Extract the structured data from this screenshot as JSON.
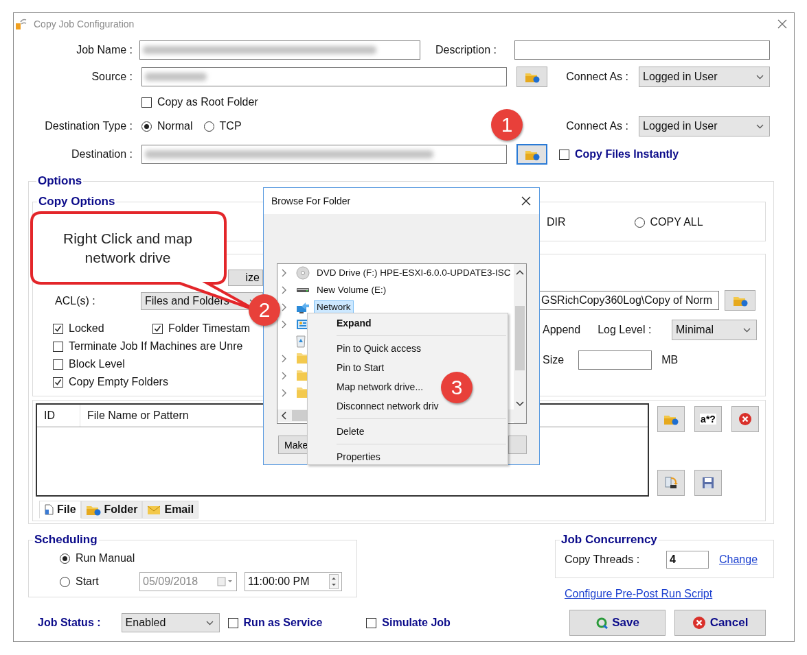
{
  "window": {
    "title": "Copy Job Configuration"
  },
  "job_name": {
    "label": "Job Name :"
  },
  "description": {
    "label": "Description :"
  },
  "source": {
    "label": "Source :",
    "connect_as_label": "Connect As :",
    "connect_as": "Logged in User"
  },
  "copy_as_root_folder": {
    "label": "Copy as Root Folder",
    "checked": false
  },
  "destination_type": {
    "label": "Destination Type :",
    "connect_as_label": "Connect As :",
    "connect_as": "Logged in User",
    "options": [
      {
        "label": "Normal",
        "selected": true
      },
      {
        "label": "TCP",
        "selected": false
      }
    ]
  },
  "destination": {
    "label": "Destination :",
    "browse_focused": true,
    "copy_files_instantly": {
      "label": "Copy Files Instantly",
      "checked": false
    }
  },
  "options": {
    "title": "Options",
    "copy_options": {
      "title": "Copy Options",
      "choices": [
        {
          "label": "DIR"
        },
        {
          "label": "COPY ALL",
          "selected": false
        }
      ]
    },
    "size_button": "ize",
    "acl_label": "ACL(s) :",
    "acl": "Files and Folders",
    "checks": [
      {
        "label": "Locked",
        "checked": true
      },
      {
        "label": "Folder Timestam",
        "checked": true
      },
      {
        "label": "Terminate Job If Machines are Unre",
        "checked": false
      },
      {
        "label": "Block Level",
        "checked": false
      },
      {
        "label": "Copy Empty Folders",
        "checked": true
      }
    ],
    "log_path": "GSRichCopy360Log\\Copy of Norm",
    "append_label": "Append",
    "log_level_label": "Log Level :",
    "log_level": "Minimal",
    "size_label": "Size",
    "size_unit": "MB"
  },
  "filters": {
    "columns": [
      "ID",
      "File Name or Pattern"
    ],
    "pattern_button": "a*?",
    "tabs": [
      {
        "label": "File",
        "kind": "file",
        "selected": true
      },
      {
        "label": "Folder",
        "kind": "folder",
        "selected": false
      },
      {
        "label": "Email",
        "kind": "email",
        "selected": false
      }
    ]
  },
  "scheduling": {
    "title": "Scheduling",
    "options": [
      {
        "label": "Run Manual",
        "selected": true
      },
      {
        "label": "Start",
        "selected": false
      }
    ],
    "date": "05/09/2018",
    "date_disabled": true,
    "time": "11:00:00 PM"
  },
  "job_concurrency": {
    "title": "Job Concurrency",
    "threads_label": "Copy Threads :",
    "threads": "4",
    "change_link": "Change"
  },
  "pre_post_link": "Configure Pre-Post Run Script",
  "job_status": {
    "label": "Job Status :",
    "value": "Enabled"
  },
  "run_as_service": {
    "label": "Run as Service",
    "checked": false
  },
  "simulate_job": {
    "label": "Simulate Job",
    "checked": false
  },
  "buttons": {
    "save": "Save",
    "cancel": "Cancel"
  },
  "browse_dialog": {
    "title": "Browse For Folder",
    "tree": [
      {
        "label": "DVD Drive (F:) HPE-ESXI-6.0.0-UPDATE3-ISC",
        "kind": "disc",
        "expandable": true,
        "selected": false
      },
      {
        "label": "New Volume (E:)",
        "kind": "drive",
        "expandable": true,
        "selected": false
      },
      {
        "label": "Network",
        "kind": "network",
        "expandable": true,
        "selected": true
      },
      {
        "kind": "control-panel",
        "expandable": true,
        "selected": false
      },
      {
        "kind": "recycle-bin",
        "expandable": false,
        "selected": false
      },
      {
        "kind": "folder",
        "expandable": true,
        "selected": false
      },
      {
        "kind": "folder",
        "expandable": true,
        "selected": false
      },
      {
        "kind": "folder",
        "expandable": true,
        "selected": false
      }
    ],
    "button": "Make"
  },
  "context_menu": {
    "groups": [
      [
        {
          "label": "Expand",
          "default": true
        }
      ],
      [
        {
          "label": "Pin to Quick access",
          "default": false
        },
        {
          "label": "Pin to Start",
          "default": false
        },
        {
          "label": "Map network drive...",
          "default": false
        },
        {
          "label": "Disconnect network driv",
          "default": false
        }
      ],
      [
        {
          "label": "Delete",
          "default": false
        }
      ],
      [
        {
          "label": "Properties",
          "default": false
        }
      ]
    ]
  },
  "annotations": {
    "callout": "Right Click and map network drive",
    "badges": [
      "1",
      "2",
      "3"
    ]
  }
}
